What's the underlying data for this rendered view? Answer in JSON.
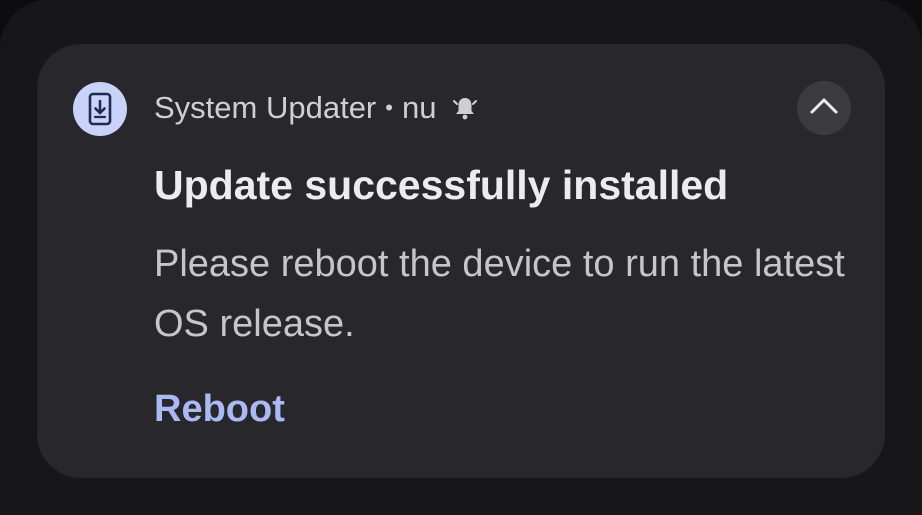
{
  "notification": {
    "app_name": "System Updater",
    "separator": "•",
    "time": "nu",
    "title": "Update successfully installed",
    "body": "Please reboot the device to run the latest OS release.",
    "action_label": "Reboot",
    "app_icon": "phone-download-icon",
    "status_icon": "alert-bell-icon",
    "expand_icon": "chevron-up-icon"
  },
  "colors": {
    "background": "#17171a",
    "card": "#28282c",
    "icon_circle": "#c9d2f8",
    "accent": "#aab8f4"
  }
}
